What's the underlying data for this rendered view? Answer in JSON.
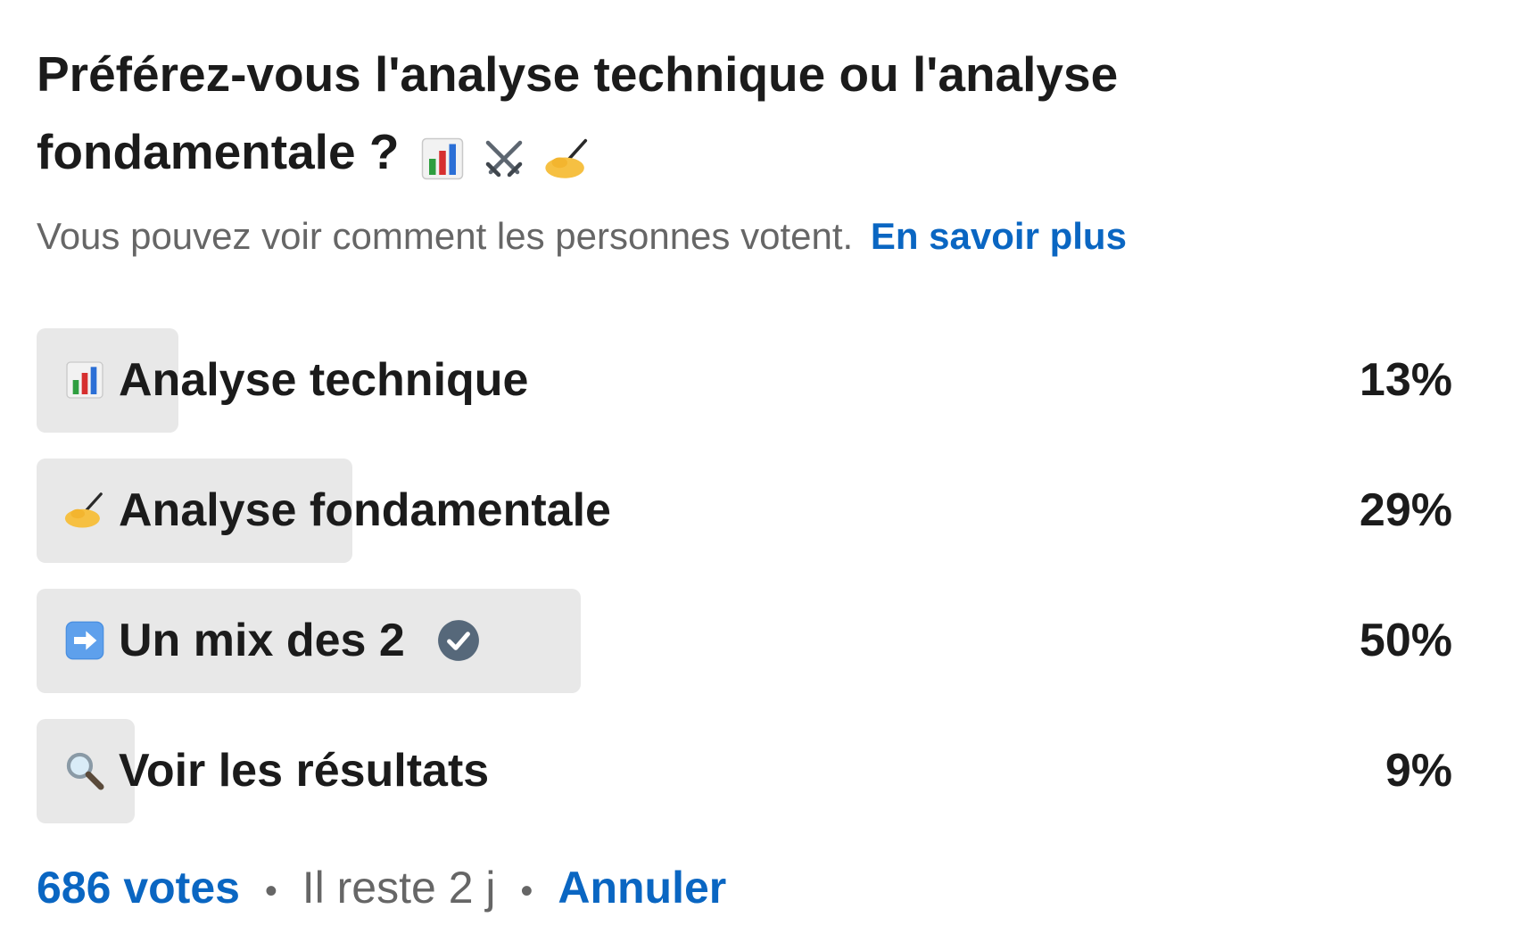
{
  "poll": {
    "question": "Préférez-vous l'analyse technique ou l'analyse fondamentale ?",
    "question_emojis": [
      "bar-chart-emoji",
      "crossed-swords-emoji",
      "writing-hand-emoji"
    ],
    "visibility_text": "Vous pouvez voir comment les personnes votent.",
    "learn_more_label": "En savoir plus",
    "options": [
      {
        "emoji": "bar-chart-emoji",
        "label": "Analyse technique",
        "percent": "13%",
        "fraction": 0.13,
        "selected": false
      },
      {
        "emoji": "writing-hand-emoji",
        "label": "Analyse fondamentale",
        "percent": "29%",
        "fraction": 0.29,
        "selected": false
      },
      {
        "emoji": "right-arrow-emoji",
        "label": "Un mix des 2",
        "percent": "50%",
        "fraction": 0.5,
        "selected": true
      },
      {
        "emoji": "magnifying-glass-emoji",
        "label": "Voir les résultats",
        "percent": "9%",
        "fraction": 0.09,
        "selected": false
      }
    ],
    "footer": {
      "votes": "686 votes",
      "separator": "•",
      "time_left": "Il reste 2 j",
      "cancel_label": "Annuler"
    }
  },
  "colors": {
    "accent": "#0a66c2",
    "bar_fill": "#e8e8e8",
    "check": "#56687a",
    "muted_text": "#666666",
    "text": "#1b1b1b"
  }
}
